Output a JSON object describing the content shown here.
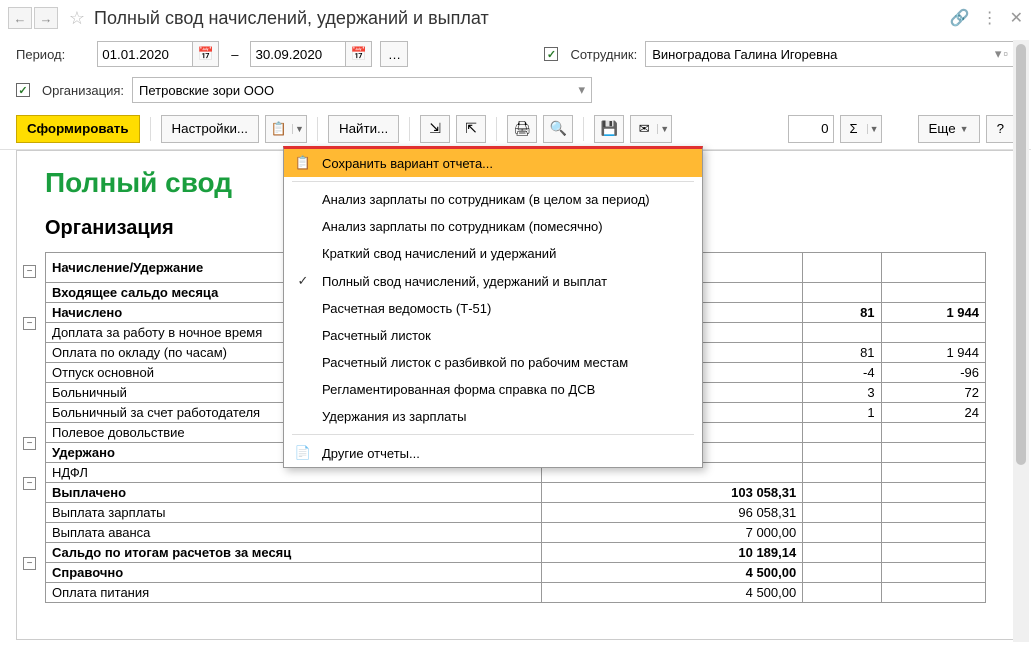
{
  "title": "Полный свод начислений, удержаний и выплат",
  "filters": {
    "period_label": "Период:",
    "date_from": "01.01.2020",
    "date_to": "30.09.2020",
    "employee_label": "Сотрудник:",
    "employee_value": "Виноградова Галина Игоревна",
    "org_label": "Организация:",
    "org_value": "Петровские зори ООО"
  },
  "toolbar": {
    "form": "Сформировать",
    "settings": "Настройки...",
    "find": "Найти...",
    "num_value": "0",
    "more": "Еще",
    "help": "?"
  },
  "menu": {
    "save_variant": "Сохранить вариант отчета...",
    "items": [
      "Анализ зарплаты по сотрудникам (в целом за период)",
      "Анализ зарплаты по сотрудникам (помесячно)",
      "Краткий свод начислений и удержаний",
      "Полный свод начислений, удержаний и выплат",
      "Расчетная ведомость (Т-51)",
      "Расчетный листок",
      "Расчетный листок с разбивкой по рабочим местам",
      "Регламентированная форма справка по ДСВ",
      "Удержания из зарплаты"
    ],
    "checked_index": 3,
    "other": "Другие отчеты..."
  },
  "report": {
    "title_visible": "Полный свод                                             плат",
    "org_heading": "Организация",
    "col_header": "Начисление/Удержание",
    "rows": [
      {
        "label": "Входящее сальдо месяца",
        "bold": true
      },
      {
        "label": "Начислено",
        "bold": true,
        "c1": "81",
        "c2": "1 944"
      },
      {
        "label": "Доплата за работу в ночное время"
      },
      {
        "label": "Оплата по окладу (по часам)",
        "c1": "81",
        "c2": "1 944"
      },
      {
        "label": "Отпуск основной",
        "c1": "-4",
        "c2": "-96"
      },
      {
        "label": "Больничный",
        "c1": "3",
        "c2": "72"
      },
      {
        "label": "Больничный за счет работодателя",
        "c1": "1",
        "c2": "24"
      },
      {
        "label": "Полевое довольствие"
      },
      {
        "label": "Удержано",
        "bold": true
      },
      {
        "label": "НДФЛ"
      },
      {
        "label": "Выплачено",
        "bold": true,
        "c0": "103 058,31"
      },
      {
        "label": "Выплата зарплаты",
        "c0": "96 058,31"
      },
      {
        "label": "Выплата аванса",
        "c0": "7 000,00"
      },
      {
        "label": "Сальдо по итогам расчетов за месяц",
        "bold": true,
        "c0": "10 189,14"
      },
      {
        "label": "Справочно",
        "bold": true,
        "c0": "4 500,00"
      },
      {
        "label": "Оплата питания",
        "c0": "4 500,00"
      }
    ]
  }
}
